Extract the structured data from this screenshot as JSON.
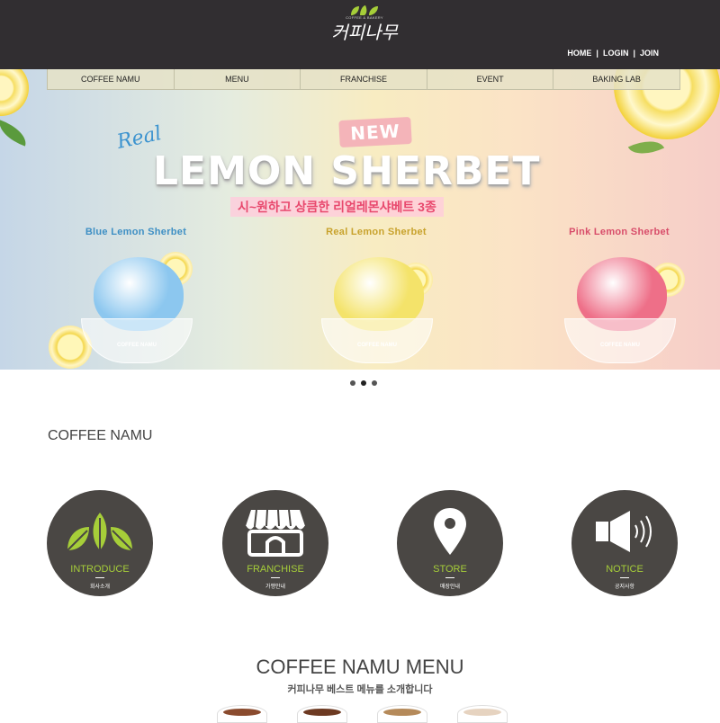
{
  "header": {
    "logo_tagline": "COFFEE & BAKERY",
    "logo_text": "커피나무",
    "util_links": [
      "HOME",
      "LOGIN",
      "JOIN"
    ]
  },
  "nav": {
    "items": [
      "COFFEE NAMU",
      "MENU",
      "FRANCHISE",
      "EVENT",
      "BAKING LAB"
    ]
  },
  "hero": {
    "badge": "NEW",
    "script": "Real",
    "title": "LEMON SHERBET",
    "subtitle": "시~원하고 상큼한 리얼레몬샤베트 3종",
    "products": [
      {
        "name": "Blue Lemon Sherbet",
        "color": "#3e8fc4",
        "scoop_color": "#8cc7ef",
        "cup_label": "COFFEE NAMU"
      },
      {
        "name": "Real Lemon Sherbet",
        "color": "#c8a22c",
        "scoop_color": "#f4e36a",
        "cup_label": "COFFEE NAMU"
      },
      {
        "name": "Pink Lemon Sherbet",
        "color": "#d84d6a",
        "scoop_color": "#ee6f88",
        "cup_label": "COFFEE NAMU"
      }
    ],
    "slide_count": 3,
    "active_slide": 2
  },
  "about": {
    "title": "COFFEE NAMU",
    "cards": [
      {
        "title": "INTRODUCE",
        "subtitle": "회사소개",
        "icon": "leaves-icon"
      },
      {
        "title": "FRANCHISE",
        "subtitle": "가맹안내",
        "icon": "store-icon"
      },
      {
        "title": "STORE",
        "subtitle": "매장안내",
        "icon": "location-pin-icon"
      },
      {
        "title": "NOTICE",
        "subtitle": "공지사항",
        "icon": "megaphone-icon"
      }
    ]
  },
  "menu": {
    "title": "COFFEE NAMU MENU",
    "subtitle": "커피나무 베스트 메뉴를 소개합니다"
  },
  "colors": {
    "header_bg": "#312e31",
    "accent_green": "#a6ce39",
    "circle_bg": "#4a4744"
  }
}
